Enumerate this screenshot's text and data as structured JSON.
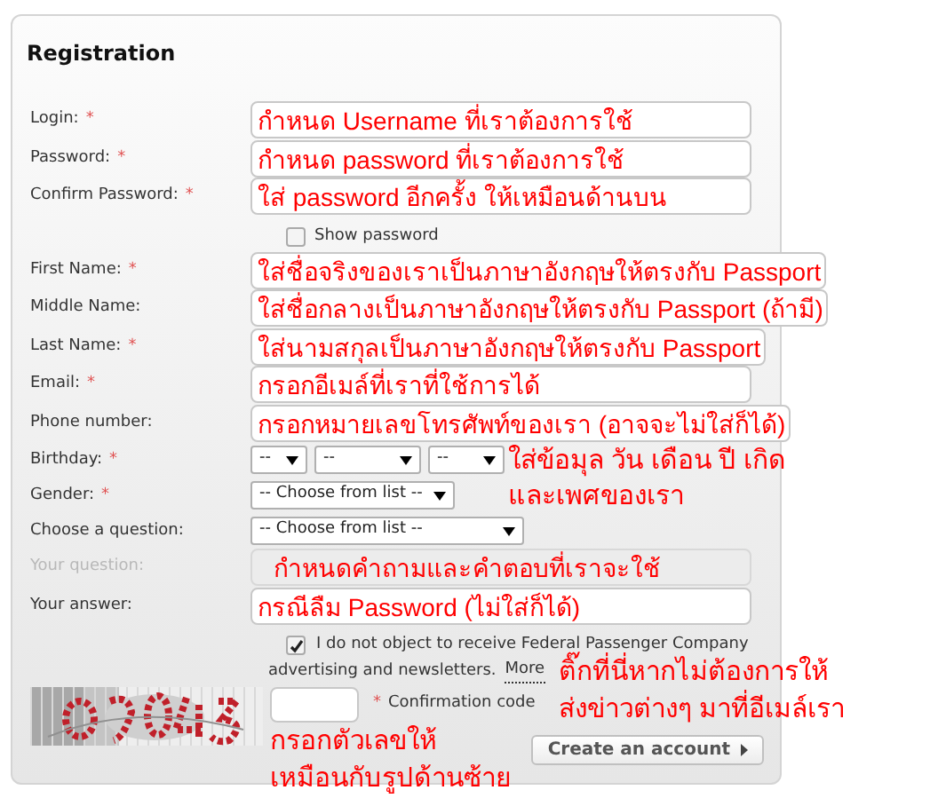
{
  "title": "Registration",
  "rows": [
    {
      "kind": "text",
      "label": "Login:",
      "asterisk": "*",
      "disabled": false,
      "note": "กำหนด Username ที่เราต้องการใช้"
    },
    {
      "kind": "text",
      "label": "Password:",
      "asterisk": "*",
      "disabled": false,
      "note": "กำหนด password ที่เราต้องการใช้"
    },
    {
      "kind": "text",
      "label": "Confirm Password:",
      "asterisk": "*",
      "disabled": false,
      "note": "ใส่ password อีกครั้ง ให้เหมือนด้านบน"
    },
    {
      "kind": "checkbox",
      "label": "Show password",
      "checked": false
    },
    {
      "kind": "text",
      "label": "First Name:",
      "asterisk": "*",
      "disabled": false,
      "note": "ใส่ชื่อจริงของเราเป็นภาษาอังกฤษให้ตรงกับ Passport"
    },
    {
      "kind": "text",
      "label": "Middle Name:",
      "disabled": false,
      "note": "ใส่ชื่อกลางเป็นภาษาอังกฤษให้ตรงกับ Passport (ถ้ามี)"
    },
    {
      "kind": "text",
      "label": "Last Name:",
      "asterisk": "*",
      "disabled": false,
      "note": "ใส่นามสกุลเป็นภาษาอังกฤษให้ตรงกับ Passport"
    },
    {
      "kind": "text",
      "label": "Email:",
      "asterisk": "*",
      "disabled": false,
      "note": "กรอกอีเมล์ที่เราที่ใช้การได้"
    },
    {
      "kind": "text",
      "label": "Phone number:",
      "disabled": false,
      "note": "กรอกหมายเลขโทรศัพท์ของเรา (อาจจะไม่ใส่ก็ได้)"
    },
    {
      "kind": "dates",
      "label": "Birthday:",
      "asterisk": "*",
      "selects": [
        "--",
        "--",
        "--"
      ],
      "note_lines": [
        "ใส่ข้อมุล วัน เดือน ปี เกิด",
        "และเพศของเรา"
      ]
    },
    {
      "kind": "select",
      "label": "Gender:",
      "asterisk": "*",
      "value": "-- Choose from list --",
      "wide": false
    },
    {
      "kind": "select",
      "label": "Choose a question:",
      "value": "-- Choose from list --",
      "wide": true
    },
    {
      "kind": "text",
      "label": "Your question:",
      "disabled": true,
      "note": "กำหนดคำถามและคำตอบที่เราจะใช้"
    },
    {
      "kind": "text",
      "label": "Your answer:",
      "disabled": false,
      "note": "กรณีลืม Password (ไม่ใส่ก็ได้)"
    }
  ],
  "newsletter": {
    "checked": true,
    "text_lines": [
      "I do not object to receive Federal Passenger Company",
      "advertising and newsletters."
    ],
    "link": "More",
    "note_lines": [
      "ติ๊กที่นี่หากไม่ต้องการให้",
      "ส่งข่าวต่างๆ มาที่อีเมล์เรา"
    ]
  },
  "captcha": {
    "asterisk": "*",
    "label": "Confirmation code",
    "note_lines": [
      "กรอกตัวเลขให้",
      "เหมือนกับรูปด้านซ้าย"
    ]
  },
  "button": "Create an account"
}
